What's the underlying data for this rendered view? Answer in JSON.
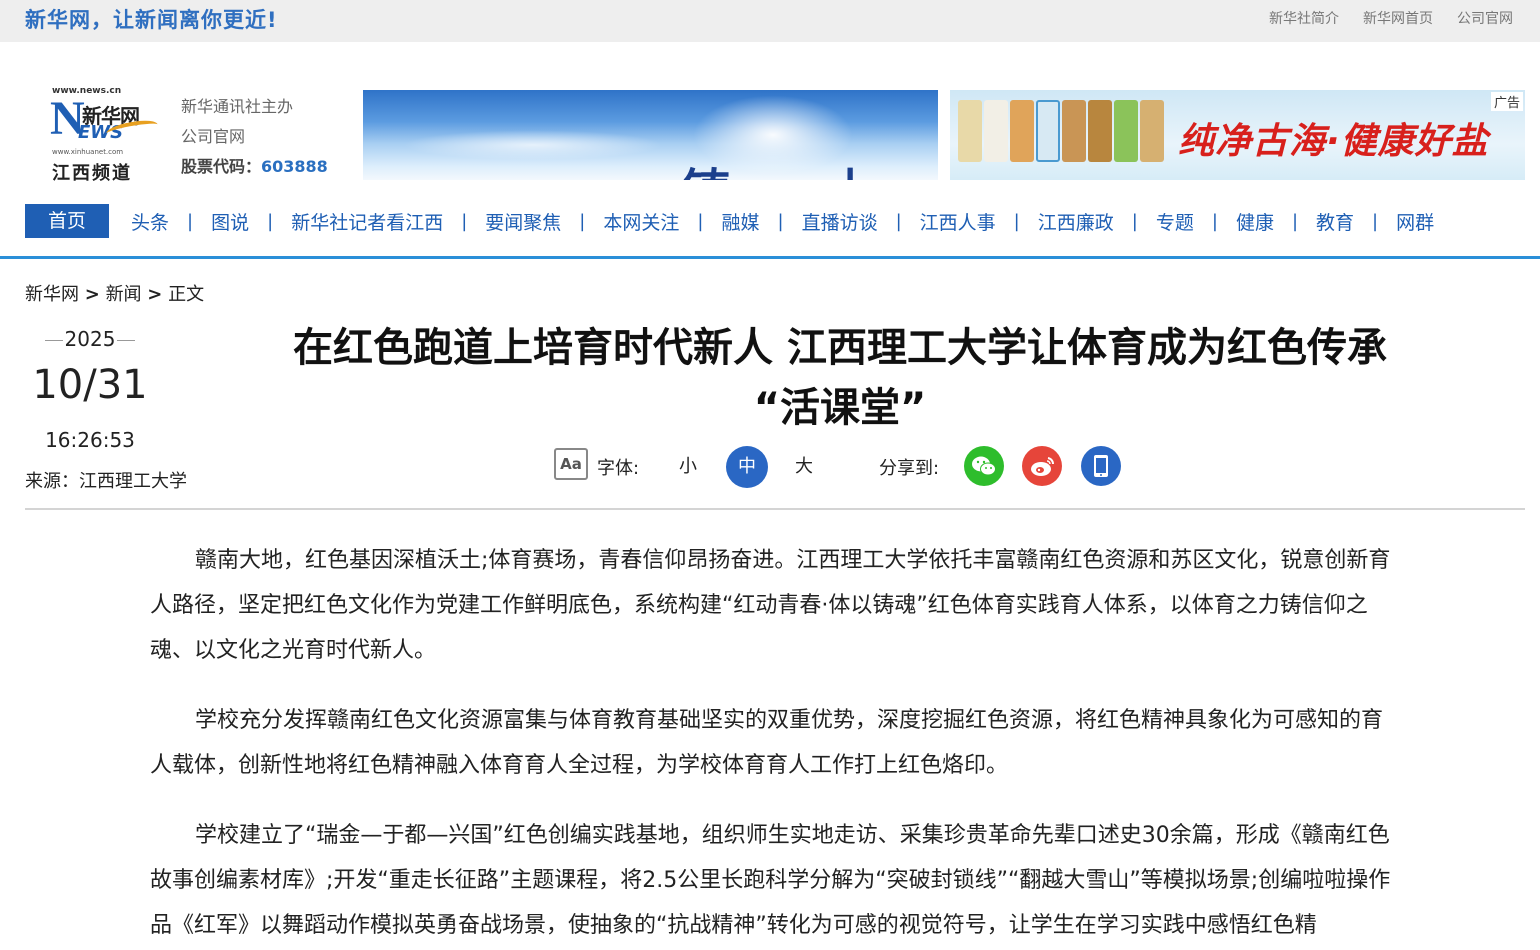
{
  "topbar": {
    "slogan": "新华网，让新闻离你更近!",
    "links": [
      "新华社简介",
      "新华网首页",
      "公司官网"
    ]
  },
  "header": {
    "logo": {
      "url_text": "www.news.cn",
      "brand": "新华网",
      "news_mark": "NEWS",
      "small_url": "www.xinhuanet.com",
      "channel": "江西频道"
    },
    "info_line1": "新华通讯社主办",
    "info_line2": "公司官网",
    "stock_label": "股票代码：",
    "stock_code": "603888"
  },
  "ads": {
    "ad1_text": "铸 上 ジ",
    "ad2_slogan": "纯净古海·健康好盐",
    "ad_tag": "广告"
  },
  "nav": {
    "home": "首页",
    "items": [
      "头条",
      "图说",
      "新华社记者看江西",
      "要闻聚焦",
      "本网关注",
      "融媒",
      "直播访谈",
      "江西人事",
      "江西廉政",
      "专题",
      "健康",
      "教育",
      "网群"
    ]
  },
  "breadcrumb": {
    "home": "新华网",
    "sep": ">",
    "section": "新闻",
    "current": "正文"
  },
  "meta": {
    "year": "2025",
    "month_day": "10/31",
    "time": "16:26:53",
    "source": "来源：江西理工大学"
  },
  "article": {
    "title_line1": "在红色跑道上培育时代新人 江西理工大学让体育成为红色传承",
    "title_line2": "“活课堂”",
    "paragraphs": [
      "赣南大地，红色基因深植沃土;体育赛场，青春信仰昂扬奋进。江西理工大学依托丰富赣南红色资源和苏区文化，锐意创新育人路径，坚定把红色文化作为党建工作鲜明底色，系统构建“红动青春·体以铸魂”红色体育实践育人体系，以体育之力铸信仰之魂、以文化之光育时代新人。",
      "学校充分发挥赣南红色文化资源富集与体育教育基础坚实的双重优势，深度挖掘红色资源，将红色精神具象化为可感知的育人载体，创新性地将红色精神融入体育育人全过程，为学校体育育人工作打上红色烙印。",
      "学校建立了“瑞金—于都—兴国”红色创编实践基地，组织师生实地走访、采集珍贵革命先辈口述史30余篇，形成《赣南红色故事创编素材库》;开发“重走长征路”主题课程，将2.5公里长跑科学分解为“突破封锁线”“翻越大雪山”等模拟场景;创编啦啦操作品《红军》以舞蹈动作模拟英勇奋战场景，使抽象的“抗战精神”转化为可感的视觉符号，让学生在学习实践中感悟红色精"
    ]
  },
  "tools": {
    "aa_icon_text": "Aa",
    "font_label": "字体:",
    "font_small": "小",
    "font_medium": "中",
    "font_large": "大",
    "font_selected": "中",
    "share_label": "分享到:",
    "share_icons": [
      "wechat-icon",
      "weibo-icon",
      "mobile-icon"
    ],
    "colors": {
      "wechat": "#2ebd2c",
      "weibo": "#e6453a",
      "mobile": "#2a67c4",
      "accent": "#1f5fb4"
    }
  }
}
